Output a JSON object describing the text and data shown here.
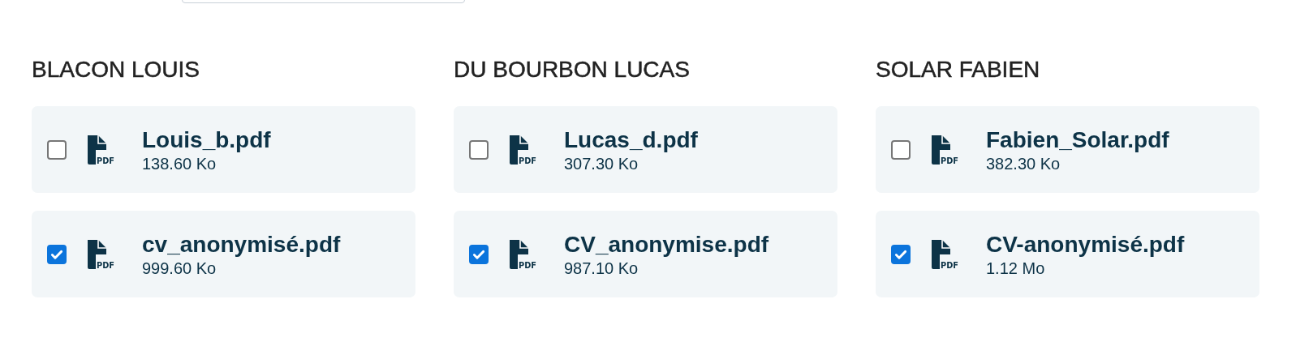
{
  "groups": [
    {
      "name": "BLACON LOUIS",
      "files": [
        {
          "filename": "Louis_b.pdf",
          "size": "138.60 Ko",
          "icon_label": "PDF",
          "checked": false
        },
        {
          "filename": "cv_anonymisé.pdf",
          "size": "999.60 Ko",
          "icon_label": "PDF",
          "checked": true
        }
      ]
    },
    {
      "name": "DU BOURBON LUCAS",
      "files": [
        {
          "filename": "Lucas_d.pdf",
          "size": "307.30 Ko",
          "icon_label": "PDF",
          "checked": false
        },
        {
          "filename": "CV_anonymise.pdf",
          "size": "987.10 Ko",
          "icon_label": "PDF",
          "checked": true
        }
      ]
    },
    {
      "name": "SOLAR FABIEN",
      "files": [
        {
          "filename": "Fabien_Solar.pdf",
          "size": "382.30 Ko",
          "icon_label": "PDF",
          "checked": false
        },
        {
          "filename": "CV-anonymisé.pdf",
          "size": "1.12 Mo",
          "icon_label": "PDF",
          "checked": true
        }
      ]
    }
  ]
}
